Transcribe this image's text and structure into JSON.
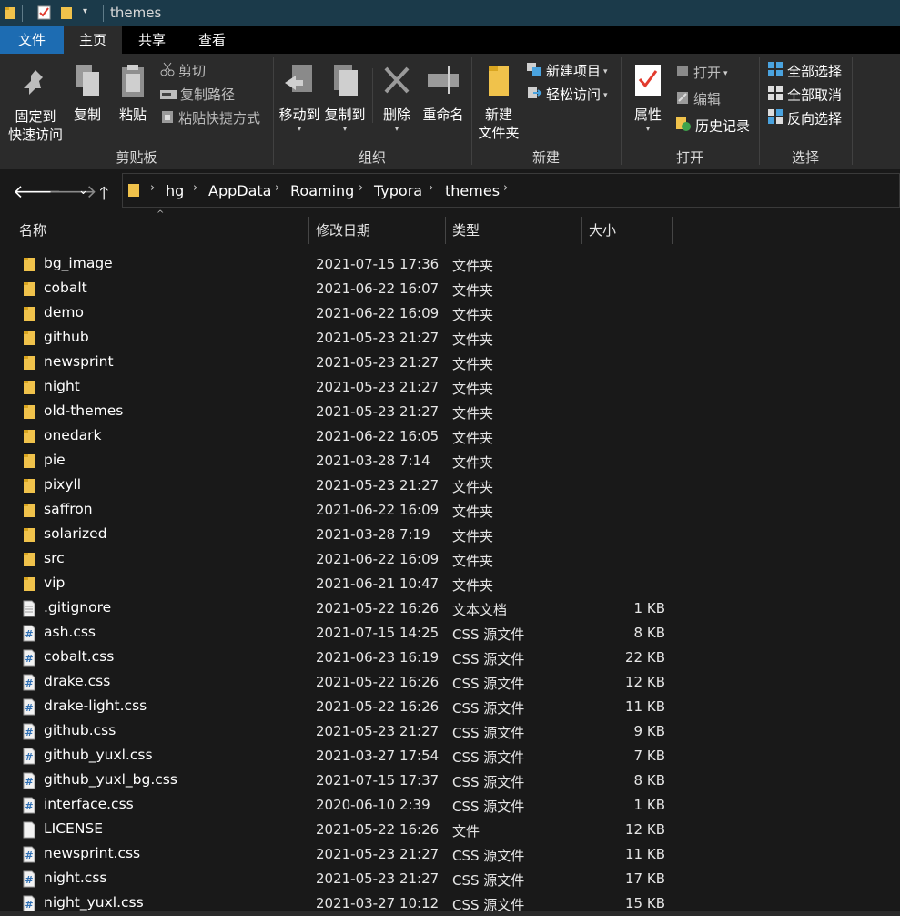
{
  "window": {
    "title": "themes"
  },
  "tabs": [
    {
      "label": "文件"
    },
    {
      "label": "主页"
    },
    {
      "label": "共享"
    },
    {
      "label": "查看"
    }
  ],
  "ribbon": {
    "clipboard": {
      "group_label": "剪贴板",
      "pin": "固定到\n快速访问",
      "pin_line1": "固定到",
      "pin_line2": "快速访问",
      "copy": "复制",
      "paste": "粘贴",
      "cut": "剪切",
      "copy_path": "复制路径",
      "paste_shortcut": "粘贴快捷方式"
    },
    "organize": {
      "group_label": "组织",
      "move_to": "移动到",
      "copy_to": "复制到",
      "delete": "删除",
      "rename": "重命名"
    },
    "new": {
      "group_label": "新建",
      "new_folder_line1": "新建",
      "new_folder_line2": "文件夹",
      "new_item": "新建项目",
      "easy_access": "轻松访问"
    },
    "open": {
      "group_label": "打开",
      "properties": "属性",
      "open": "打开",
      "edit": "编辑",
      "history": "历史记录"
    },
    "select": {
      "group_label": "选择",
      "select_all": "全部选择",
      "select_none": "全部取消",
      "invert": "反向选择"
    }
  },
  "breadcrumb": [
    "hg",
    "AppData",
    "Roaming",
    "Typora",
    "themes"
  ],
  "columns": {
    "name": "名称",
    "date": "修改日期",
    "type": "类型",
    "size": "大小"
  },
  "files": [
    {
      "icon": "folder-icon",
      "name": "bg_image",
      "date": "2021-07-15 17:36",
      "type": "文件夹",
      "size": ""
    },
    {
      "icon": "folder-icon",
      "name": "cobalt",
      "date": "2021-06-22 16:07",
      "type": "文件夹",
      "size": ""
    },
    {
      "icon": "folder-icon",
      "name": "demo",
      "date": "2021-06-22 16:09",
      "type": "文件夹",
      "size": ""
    },
    {
      "icon": "folder-icon",
      "name": "github",
      "date": "2021-05-23 21:27",
      "type": "文件夹",
      "size": ""
    },
    {
      "icon": "folder-icon",
      "name": "newsprint",
      "date": "2021-05-23 21:27",
      "type": "文件夹",
      "size": ""
    },
    {
      "icon": "folder-icon",
      "name": "night",
      "date": "2021-05-23 21:27",
      "type": "文件夹",
      "size": ""
    },
    {
      "icon": "folder-icon",
      "name": "old-themes",
      "date": "2021-05-23 21:27",
      "type": "文件夹",
      "size": ""
    },
    {
      "icon": "folder-icon",
      "name": "onedark",
      "date": "2021-06-22 16:05",
      "type": "文件夹",
      "size": ""
    },
    {
      "icon": "folder-icon",
      "name": "pie",
      "date": "2021-03-28 7:14",
      "type": "文件夹",
      "size": ""
    },
    {
      "icon": "folder-icon",
      "name": "pixyll",
      "date": "2021-05-23 21:27",
      "type": "文件夹",
      "size": ""
    },
    {
      "icon": "folder-icon",
      "name": "saffron",
      "date": "2021-06-22 16:09",
      "type": "文件夹",
      "size": ""
    },
    {
      "icon": "folder-icon",
      "name": "solarized",
      "date": "2021-03-28 7:19",
      "type": "文件夹",
      "size": ""
    },
    {
      "icon": "folder-icon",
      "name": "src",
      "date": "2021-06-22 16:09",
      "type": "文件夹",
      "size": ""
    },
    {
      "icon": "folder-icon",
      "name": "vip",
      "date": "2021-06-21 10:47",
      "type": "文件夹",
      "size": ""
    },
    {
      "icon": "text-file-icon",
      "name": ".gitignore",
      "date": "2021-05-22 16:26",
      "type": "文本文档",
      "size": "1 KB"
    },
    {
      "icon": "css-file-icon",
      "name": "ash.css",
      "date": "2021-07-15 14:25",
      "type": "CSS 源文件",
      "size": "8 KB"
    },
    {
      "icon": "css-file-icon",
      "name": "cobalt.css",
      "date": "2021-06-23 16:19",
      "type": "CSS 源文件",
      "size": "22 KB"
    },
    {
      "icon": "css-file-icon",
      "name": "drake.css",
      "date": "2021-05-22 16:26",
      "type": "CSS 源文件",
      "size": "12 KB"
    },
    {
      "icon": "css-file-icon",
      "name": "drake-light.css",
      "date": "2021-05-22 16:26",
      "type": "CSS 源文件",
      "size": "11 KB"
    },
    {
      "icon": "css-file-icon",
      "name": "github.css",
      "date": "2021-05-23 21:27",
      "type": "CSS 源文件",
      "size": "9 KB"
    },
    {
      "icon": "css-file-icon",
      "name": "github_yuxl.css",
      "date": "2021-03-27 17:54",
      "type": "CSS 源文件",
      "size": "7 KB"
    },
    {
      "icon": "css-file-icon",
      "name": "github_yuxl_bg.css",
      "date": "2021-07-15 17:37",
      "type": "CSS 源文件",
      "size": "8 KB"
    },
    {
      "icon": "css-file-icon",
      "name": "interface.css",
      "date": "2020-06-10 2:39",
      "type": "CSS 源文件",
      "size": "1 KB"
    },
    {
      "icon": "blank-file-icon",
      "name": "LICENSE",
      "date": "2021-05-22 16:26",
      "type": "文件",
      "size": "12 KB"
    },
    {
      "icon": "css-file-icon",
      "name": "newsprint.css",
      "date": "2021-05-23 21:27",
      "type": "CSS 源文件",
      "size": "11 KB"
    },
    {
      "icon": "css-file-icon",
      "name": "night.css",
      "date": "2021-05-23 21:27",
      "type": "CSS 源文件",
      "size": "17 KB"
    },
    {
      "icon": "css-file-icon",
      "name": "night_yuxl.css",
      "date": "2021-03-27 10:12",
      "type": "CSS 源文件",
      "size": "15 KB"
    }
  ],
  "colors": {
    "file_tab": "#1d6cb2",
    "titlebar": "#1b3a4a",
    "background": "#191919",
    "ribbon": "#2b2b2b",
    "folder": "#f0c24b"
  }
}
